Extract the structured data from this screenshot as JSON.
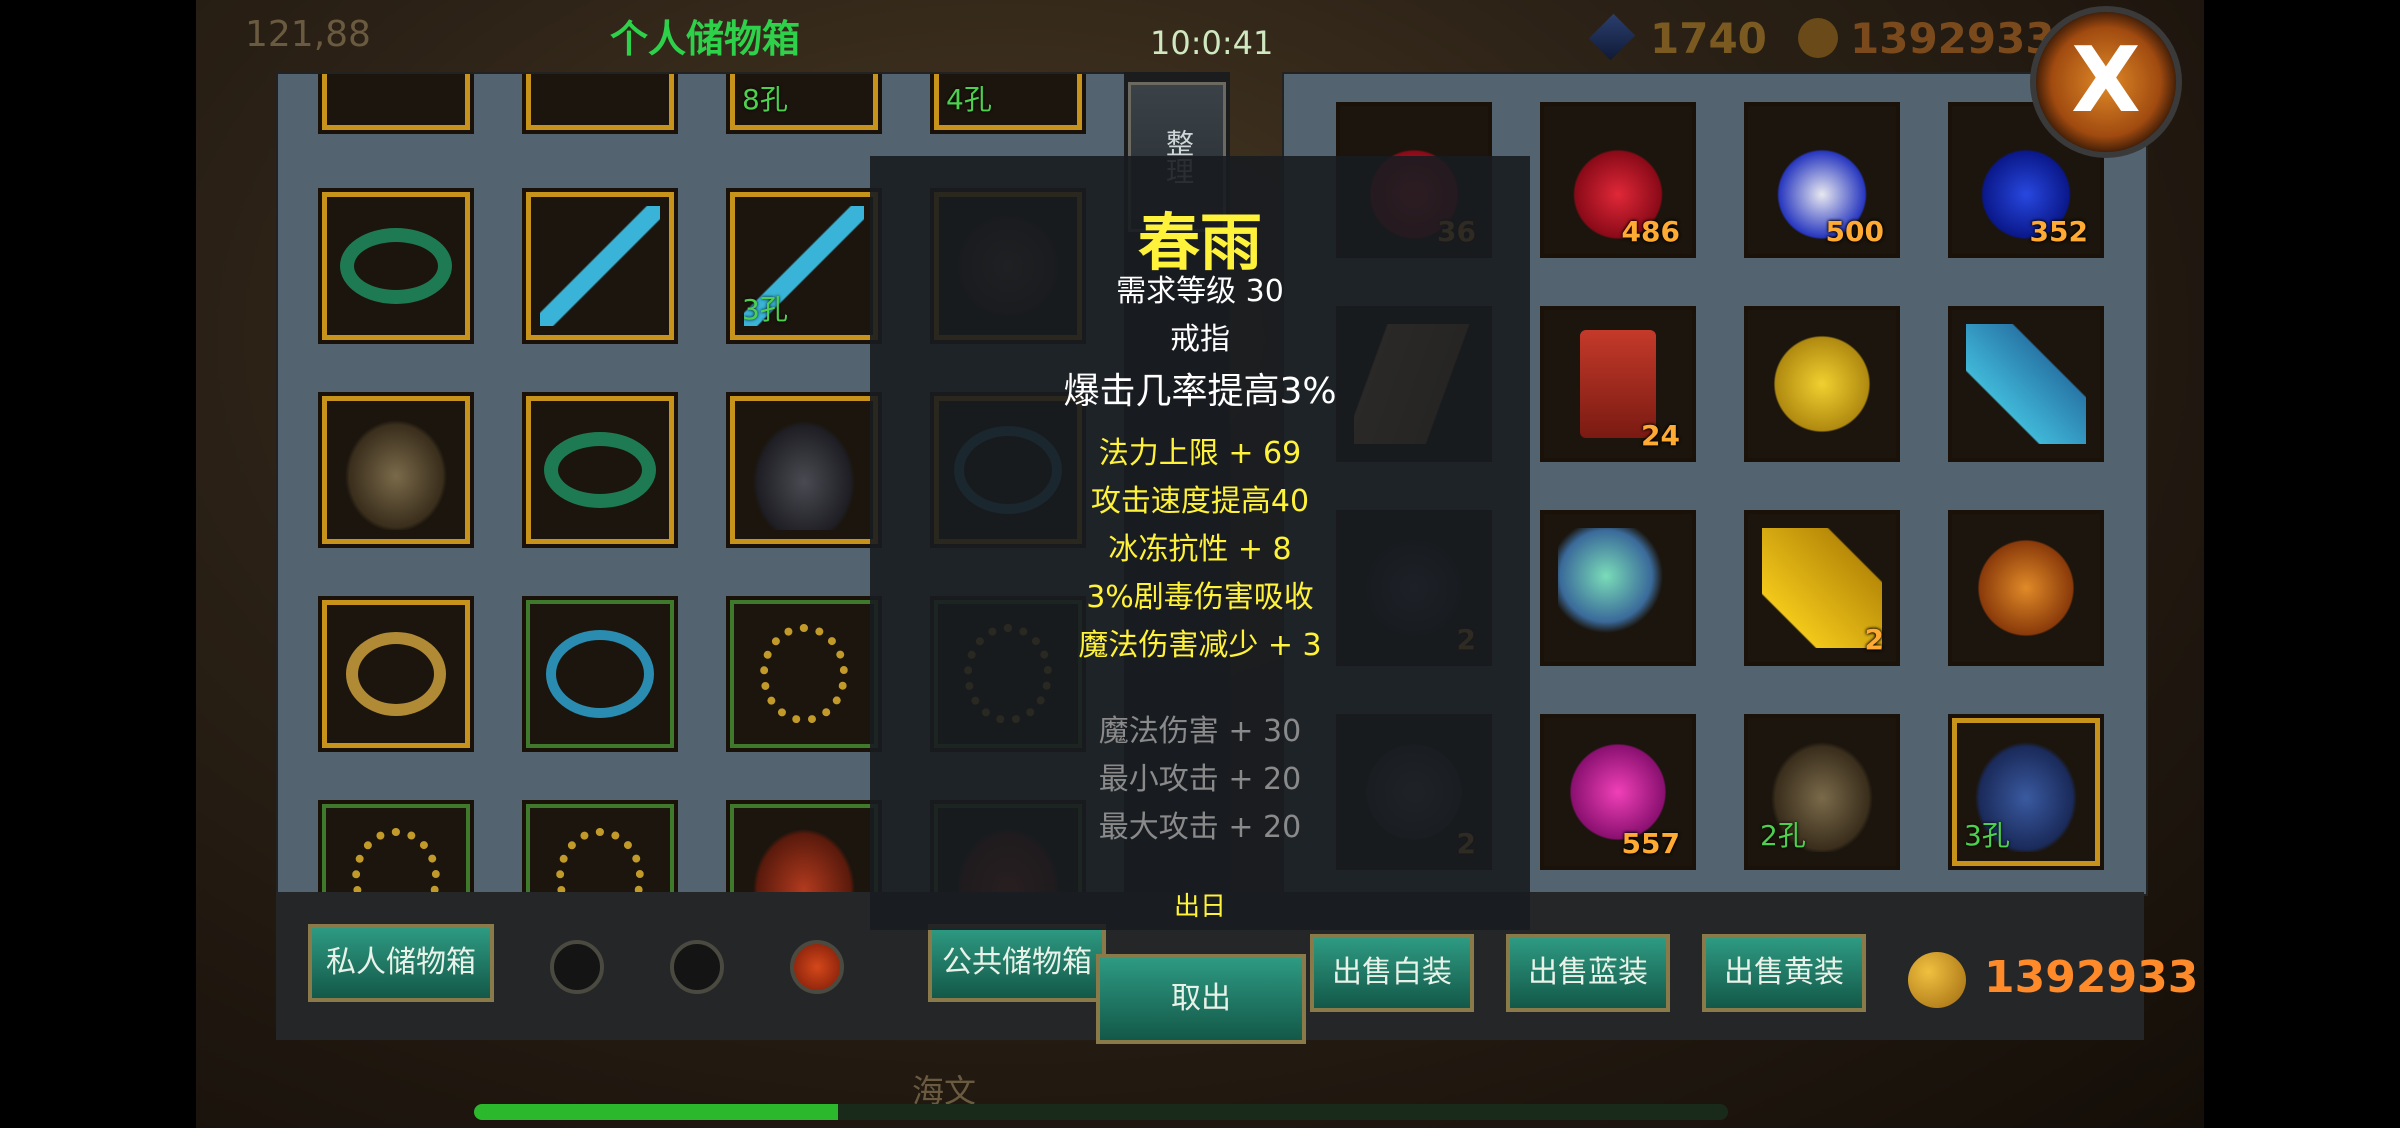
{
  "background": {
    "title": "个人储物箱",
    "coords": "121,88",
    "clock": "10:0:41",
    "resource_a": "1740",
    "resource_b": "1392933",
    "name": "海文"
  },
  "sort_button": "整理",
  "left_slots": [
    {
      "icon": "jade-ring-icon",
      "q": "gold",
      "cnt": "",
      "holes": ""
    },
    {
      "icon": "jade-sword-icon",
      "q": "gold",
      "cnt": "",
      "holes": ""
    },
    {
      "icon": "jade-sword-icon",
      "q": "gold",
      "cnt": "",
      "holes": "3孔"
    },
    {
      "icon": "shoulder-icon",
      "q": "gold",
      "cnt": "",
      "holes": ""
    },
    {
      "icon": "helmet-icon",
      "q": "gold",
      "cnt": "",
      "holes": ""
    },
    {
      "icon": "jade-ring-icon",
      "q": "gold",
      "cnt": "",
      "holes": ""
    },
    {
      "icon": "boots-icon",
      "q": "gold",
      "cnt": "",
      "holes": ""
    },
    {
      "icon": "blue-ring-icon",
      "q": "gold",
      "cnt": "",
      "holes": ""
    },
    {
      "icon": "ruby-ring-icon",
      "q": "gold",
      "cnt": "",
      "holes": ""
    },
    {
      "icon": "blue-ring-icon",
      "q": "green",
      "cnt": "",
      "holes": ""
    },
    {
      "icon": "prayer-beads-icon",
      "q": "green",
      "cnt": "",
      "holes": ""
    },
    {
      "icon": "prayer-beads-icon",
      "q": "green",
      "cnt": "",
      "holes": ""
    },
    {
      "icon": "prayer-beads-icon",
      "q": "green",
      "cnt": "",
      "holes": ""
    },
    {
      "icon": "prayer-beads-icon",
      "q": "green",
      "cnt": "",
      "holes": ""
    },
    {
      "icon": "bracer-icon",
      "q": "green",
      "cnt": "",
      "holes": ""
    },
    {
      "icon": "bracer-icon",
      "q": "green",
      "cnt": "",
      "holes": ""
    }
  ],
  "left_top_holes": [
    "",
    "",
    "8孔",
    "4孔"
  ],
  "right_slots": [
    {
      "icon": "red-blue-potion-icon",
      "q": "none",
      "cnt": "36",
      "holes": ""
    },
    {
      "icon": "red-potion-icon",
      "q": "none",
      "cnt": "486",
      "holes": ""
    },
    {
      "icon": "mixed-potion-icon",
      "q": "none",
      "cnt": "500",
      "holes": ""
    },
    {
      "icon": "blue-potion-icon",
      "q": "none",
      "cnt": "352",
      "holes": ""
    },
    {
      "icon": "scroll-icon",
      "q": "none",
      "cnt": "",
      "holes": ""
    },
    {
      "icon": "token-icon",
      "q": "none",
      "cnt": "24",
      "holes": ""
    },
    {
      "icon": "yellow-gem-icon",
      "q": "none",
      "cnt": "",
      "holes": ""
    },
    {
      "icon": "crystal-icon",
      "q": "none",
      "cnt": "",
      "holes": ""
    },
    {
      "icon": "dark-gem-icon",
      "q": "none",
      "cnt": "2",
      "holes": ""
    },
    {
      "icon": "opal-icon",
      "q": "none",
      "cnt": "",
      "holes": ""
    },
    {
      "icon": "topaz-icon",
      "q": "none",
      "cnt": "2",
      "holes": ""
    },
    {
      "icon": "amber-icon",
      "q": "none",
      "cnt": "",
      "holes": ""
    },
    {
      "icon": "rune-stone-icon",
      "q": "none",
      "cnt": "2",
      "holes": ""
    },
    {
      "icon": "pink-gem-icon",
      "q": "none",
      "cnt": "557",
      "holes": ""
    },
    {
      "icon": "helmet-icon",
      "q": "none",
      "cnt": "",
      "holes": "2孔"
    },
    {
      "icon": "gauntlet-icon",
      "q": "gold",
      "cnt": "",
      "holes": "3孔"
    }
  ],
  "tooltip": {
    "name": "春雨",
    "level": "需求等级 30",
    "type": "戒指",
    "crit": "爆击几率提高3%",
    "attrs": [
      "法力上限 + 69",
      "攻击速度提高40",
      "冰冻抗性 + 8",
      "3%剧毒伤害吸收",
      "魔法伤害减少 + 3"
    ],
    "base": [
      "魔法伤害 + 30",
      "最小攻击 + 20",
      "最大攻击 + 20"
    ],
    "cut_text": "出日"
  },
  "buttons": {
    "private_storage": "私人储物箱",
    "public_storage": "公共储物箱",
    "cancel": "取出",
    "sell_white": "出售白装",
    "sell_blue": "出售蓝装",
    "sell_yellow": "出售黄装",
    "close": "X"
  },
  "pages": {
    "count": 3,
    "active_index": 2
  },
  "gold": "1392933",
  "progress": 0.29
}
